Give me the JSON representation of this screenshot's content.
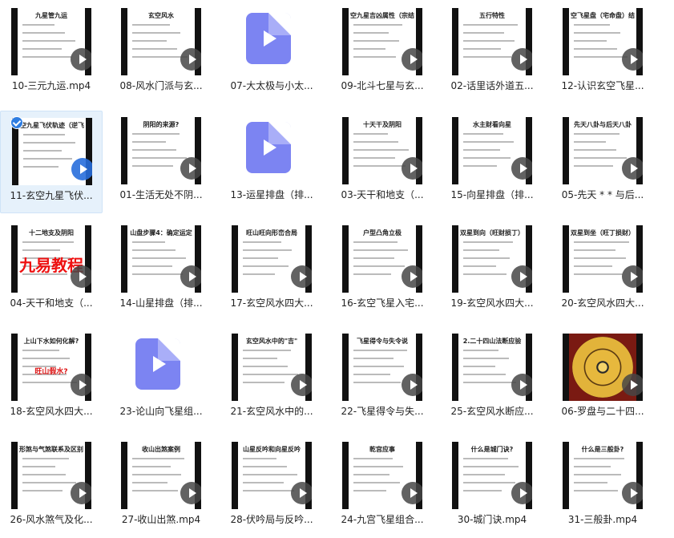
{
  "files": [
    {
      "name": "10-三元九运.mp4",
      "kind": "video",
      "thumb_title": "九星管九运"
    },
    {
      "name": "08-风水门派与玄...",
      "kind": "video",
      "thumb_title": "玄空风水"
    },
    {
      "name": "07-大太极与小太...",
      "kind": "file"
    },
    {
      "name": "09-北斗七星与玄...",
      "kind": "video",
      "thumb_title": "空九星吉凶属性（宗结"
    },
    {
      "name": "02-话里话外道五...",
      "kind": "video",
      "thumb_title": "五行特性"
    },
    {
      "name": "12-认识玄空飞星...",
      "kind": "video",
      "thumb_title": "空飞星盘（宅命盘）结"
    },
    {
      "name": "11-玄空九星飞伏...",
      "kind": "video",
      "thumb_title": "空九星飞伏轨迹（逆飞",
      "selected": true
    },
    {
      "name": "01-生活无处不阴...",
      "kind": "video",
      "thumb_title": "阴阳的来源?"
    },
    {
      "name": "13-运星排盘（排...",
      "kind": "file"
    },
    {
      "name": "03-天干和地支（...",
      "kind": "video",
      "thumb_title": "十天干及阴阳"
    },
    {
      "name": "15-向星排盘（排...",
      "kind": "video",
      "thumb_title": "水主财看向星"
    },
    {
      "name": "05-先天 *  * 与后...",
      "kind": "video",
      "thumb_title": "先天八卦与后天八卦"
    },
    {
      "name": "04-天干和地支（...",
      "kind": "video",
      "thumb_title": "十二地支及阴阳",
      "banner": "九易教程"
    },
    {
      "name": "14-山星排盘（排...",
      "kind": "video",
      "thumb_title": "山盘步骤4：确定运定"
    },
    {
      "name": "17-玄空风水四大...",
      "kind": "video",
      "thumb_title": "旺山旺向形峦合局"
    },
    {
      "name": "16-玄空飞星入宅...",
      "kind": "video",
      "thumb_title": "户型凸角立极"
    },
    {
      "name": "19-玄空风水四大...",
      "kind": "video",
      "thumb_title": "双星到向（旺财损丁）"
    },
    {
      "name": "20-玄空风水四大...",
      "kind": "video",
      "thumb_title": "双星到坐（旺丁损财）"
    },
    {
      "name": "18-玄空风水四大...",
      "kind": "video",
      "thumb_title": "上山下水如何化解?",
      "sub": "旺山假水?"
    },
    {
      "name": "23-论山向飞星组...",
      "kind": "file"
    },
    {
      "name": "21-玄空风水中的...",
      "kind": "video",
      "thumb_title": "玄空风水中的\"吉\""
    },
    {
      "name": "22-飞星得令与失...",
      "kind": "video",
      "thumb_title": "飞星得令与失令说"
    },
    {
      "name": "25-玄空风水断应...",
      "kind": "video",
      "thumb_title": "2.二十四山法断应验"
    },
    {
      "name": "06-罗盘与二十四...",
      "kind": "video",
      "luopan": true
    },
    {
      "name": "26-风水煞气及化...",
      "kind": "video",
      "thumb_title": "形煞与气煞联系及区别"
    },
    {
      "name": "27-收山出煞.mp4",
      "kind": "video",
      "thumb_title": "收山出煞案例"
    },
    {
      "name": "28-伏吟局与反吟...",
      "kind": "video",
      "thumb_title": "山星反吟和向星反吟"
    },
    {
      "name": "24-九宫飞星组合...",
      "kind": "video",
      "thumb_title": "乾宫应事"
    },
    {
      "name": "30-城门诀.mp4",
      "kind": "video",
      "thumb_title": "什么是城门诀?"
    },
    {
      "name": "31-三般卦.mp4",
      "kind": "video",
      "thumb_title": "什么是三般卦?"
    }
  ]
}
